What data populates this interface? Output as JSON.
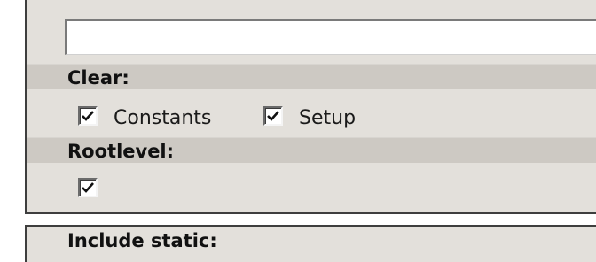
{
  "top_cut_text": "...",
  "text_field": {
    "value": "",
    "placeholder": ""
  },
  "sections": {
    "clear": {
      "label": "Clear:",
      "options": [
        {
          "label": "Constants",
          "checked": true
        },
        {
          "label": "Setup",
          "checked": true
        }
      ]
    },
    "rootlevel": {
      "label": "Rootlevel:",
      "checked": true
    }
  },
  "next_section": {
    "label": "Include static:"
  },
  "icons": {
    "checkmark": "check-icon"
  }
}
